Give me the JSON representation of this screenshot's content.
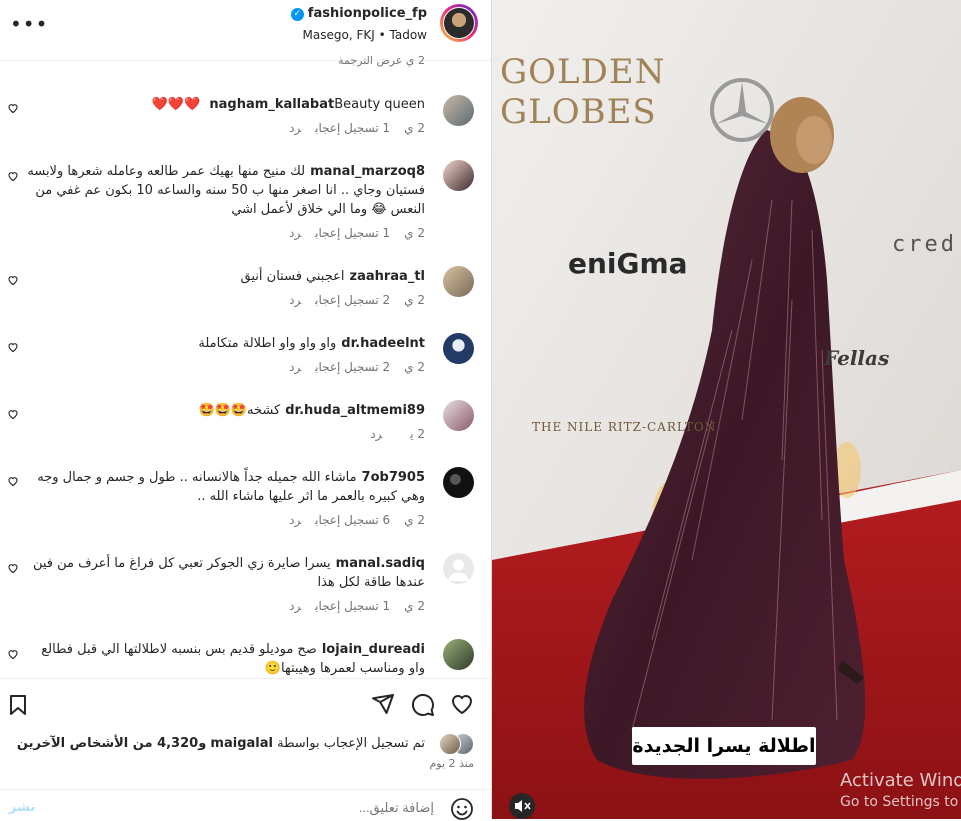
{
  "header": {
    "username": "fashionpolice_fp",
    "subtitle_location": "Masego, FKJ",
    "subtitle_audio": "Tadow",
    "more_icon": "more-dots-icon"
  },
  "top_meta": "2 ي   عرض الترجمة",
  "comments": [
    {
      "user": "nagham_kallabat",
      "text": "Beauty queen ❤️❤️❤️",
      "time": "2 ي",
      "likes": "1 تسجيل إعجاب",
      "reply": "رد"
    },
    {
      "user": "manal_marzoq8",
      "text": "لك منيح منها بهيك عمر طالعه وعامله شعرها ولابسه فستيان وجاي .. انا اصغر منها ب 50 سنه والساعه 10 بكون عم غفي من النعس 😂 وما الي خلاق لأعمل اشي",
      "time": "2 ي",
      "likes": "1 تسجيل إعجاب",
      "reply": "رد"
    },
    {
      "user": "zaahraa_tl",
      "text": "اعجبني فستان أنيق",
      "time": "2 ي",
      "likes": "2 تسجيل إعجاب",
      "reply": "رد"
    },
    {
      "user": "dr.hadeelnt",
      "text": "واو واو واو اطلالة متكاملة",
      "time": "2 ي",
      "likes": "2 تسجيل إعجاب",
      "reply": "رد"
    },
    {
      "user": "dr.huda_altmemi89",
      "text": "كشخه🤩🤩🤩",
      "time": "2 ي",
      "likes": "",
      "reply": "رد"
    },
    {
      "user": "7ob7905",
      "text": "ماشاء الله جميله جداً هالانسانه .. طول و جسم و جمال وجه وهي كبيره بالعمر ما اثر عليها ماشاء الله ..",
      "time": "2 ي",
      "likes": "6 تسجيل إعجاب",
      "reply": "رد"
    },
    {
      "user": "manal.sadiq",
      "text": "يسرا صايرة زي الجوكر تعبي كل فراغ ما أعرف من فين عندها طاقة لكل هذا",
      "time": "2 ي",
      "likes": "1 تسجيل إعجاب",
      "reply": "رد"
    },
    {
      "user": "lojain_dureadi",
      "text": "صح موديلو قديم بس بنسبه لاطلالتها الي قبل فطالع واو ومناسب لعمرها وهيبتها🙂",
      "time": "",
      "likes": "",
      "reply": ""
    }
  ],
  "actions": {
    "like_icon": "heart-icon",
    "comment_icon": "comment-icon",
    "share_icon": "share-icon",
    "save_icon": "bookmark-icon"
  },
  "likes_line": {
    "prefix": "تم تسجيل الإعجاب بواسطة",
    "user": "maigalal",
    "suffix": "و4,320 من الأشخاص الآخرين"
  },
  "time_ago": "منذ 2 يوم",
  "add_comment": {
    "placeholder": "إضافة تعليق...",
    "post_label": "نشر",
    "emoji_icon": "emoji-icon"
  },
  "media": {
    "caption": "اطلالة يسرا الجديدة",
    "mute_icon": "muted-speaker-icon",
    "sign_golden_globes": "GOLDEN GLOBES",
    "sign_enigma": "eniGma",
    "sign_nile_ritz": "THE NILE RITZ-CARLTON",
    "sign_fellas": "Fellas",
    "sign_credit": "cred"
  },
  "watermark": {
    "line1": "Activate Windows",
    "line2": "Go to Settings to activate Windows."
  },
  "colors": {
    "verified_blue": "#0095f6",
    "meta_gray": "#737373",
    "carpet_red": "#a8161a",
    "gown_plum": "#4a1f2e"
  }
}
